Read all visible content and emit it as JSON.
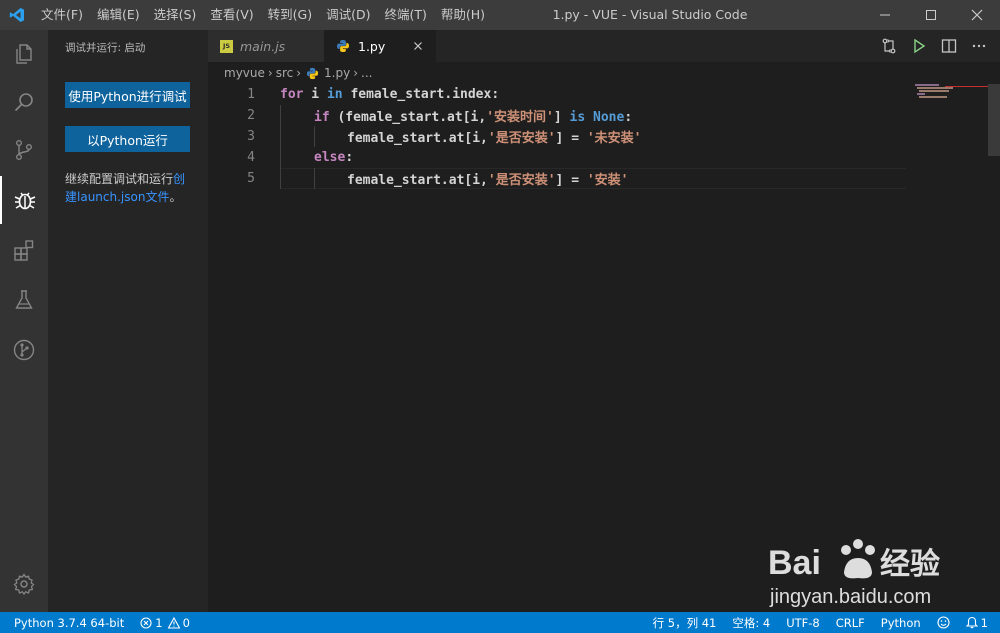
{
  "window": {
    "title": "1.py - VUE - Visual Studio Code"
  },
  "menu": [
    "文件(F)",
    "编辑(E)",
    "选择(S)",
    "查看(V)",
    "转到(G)",
    "调试(D)",
    "终端(T)",
    "帮助(H)"
  ],
  "activity_bar": {
    "items": [
      "explorer-icon",
      "search-icon",
      "source-control-icon",
      "debug-icon",
      "extensions-icon",
      "test-flask-icon",
      "git-graph-icon"
    ],
    "active": "debug-icon",
    "bottom": "gear-icon"
  },
  "sidebar": {
    "title": "调试并运行: 启动",
    "debug_button": "使用Python进行调试",
    "run_button": "以Python运行",
    "text_prefix": "继续配置调试和运行",
    "text_link": "创建launch.json文件",
    "text_suffix": "。"
  },
  "tabs": [
    {
      "label": "main.js",
      "icon": "JS",
      "active": false
    },
    {
      "label": "1.py",
      "icon": "python-icon",
      "active": true
    }
  ],
  "breadcrumb": [
    "myvue",
    "src",
    "1.py",
    "..."
  ],
  "code": {
    "lines": [
      {
        "num": "1",
        "tokens": [
          [
            "kw",
            "for"
          ],
          [
            "id",
            " i "
          ],
          [
            "bkw",
            "in"
          ],
          [
            "id",
            " female_start.index:"
          ]
        ]
      },
      {
        "num": "2",
        "tokens": [
          [
            "ctrl",
            "if"
          ],
          [
            "id",
            " (female_start.at[i,"
          ],
          [
            "str",
            "'安装时间'"
          ],
          [
            "id",
            "] "
          ],
          [
            "bkw",
            "is"
          ],
          [
            "id",
            " "
          ],
          [
            "bkw",
            "None"
          ],
          [
            "id",
            ":"
          ]
        ]
      },
      {
        "num": "3",
        "tokens": [
          [
            "id",
            "female_start.at[i,"
          ],
          [
            "str",
            "'是否安装'"
          ],
          [
            "id",
            "] = "
          ],
          [
            "str",
            "'未安装'"
          ]
        ]
      },
      {
        "num": "4",
        "tokens": [
          [
            "ctrl",
            "else"
          ],
          [
            "id",
            ":"
          ]
        ]
      },
      {
        "num": "5",
        "tokens": [
          [
            "id",
            "female_start.at[i,"
          ],
          [
            "str",
            "'是否安装'"
          ],
          [
            "id",
            "] = "
          ],
          [
            "str",
            "'安装'"
          ]
        ]
      }
    ]
  },
  "statusbar": {
    "interpreter": "Python 3.7.4 64-bit",
    "errors": "1",
    "warnings": "0",
    "position": "行 5，列 41",
    "indent": "空格: 4",
    "encoding": "UTF-8",
    "eol": "CRLF",
    "language": "Python",
    "notifications": "1"
  },
  "watermark": {
    "text": "jingyan.baidu.com"
  },
  "colors": {
    "accent": "#007acc",
    "button": "#0e639c",
    "keyword": "#c586c0",
    "builtin": "#569cd6",
    "string": "#ce9178"
  }
}
